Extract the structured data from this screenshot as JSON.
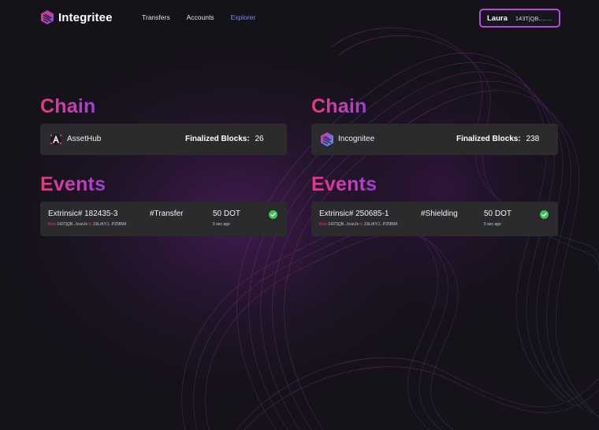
{
  "app": {
    "name": "Integritee"
  },
  "nav": {
    "items": [
      {
        "label": "Transfers"
      },
      {
        "label": "Accounts"
      },
      {
        "label": "Explorer"
      }
    ]
  },
  "account": {
    "name": "Laura",
    "address": "143TjQB........"
  },
  "panels": [
    {
      "chain_heading": "Chain",
      "chain": {
        "name": "AssetHub",
        "icon": "assethub-logo-icon",
        "finalized_label": "Finalized Blocks:",
        "finalized_value": "26"
      },
      "events_heading": "Events",
      "event": {
        "extrinsic": "Extrinsic# 182435-3",
        "type": "#Transfer",
        "amount": "50 DOT",
        "from_label": "from",
        "from": "143TjQB...5vurJs",
        "to_label": "to",
        "to": "1SLrKYJ...P25BWt",
        "time": "5 sec ago",
        "status_icon": "check-circle-icon"
      }
    },
    {
      "chain_heading": "Chain",
      "chain": {
        "name": "Incognitee",
        "icon": "incognitee-logo-icon",
        "finalized_label": "Finalized Blocks:",
        "finalized_value": "238"
      },
      "events_heading": "Events",
      "event": {
        "extrinsic": "Extrinsic# 250685-1",
        "type": "#Shielding",
        "amount": "50 DOT",
        "from_label": "from",
        "from": "143TjQB...5vurJs",
        "to_label": "to",
        "to": "1SLrKYJ...P25BWt",
        "time": "5 sec ago",
        "status_icon": "check-circle-icon"
      }
    }
  ],
  "colors": {
    "background": "#15121a",
    "card": "#2b2a2d",
    "accent_pink": "#e8357c",
    "accent_purple": "#9a3fd0",
    "nav_active": "#6f8ff3",
    "success": "#3fbf5a"
  }
}
